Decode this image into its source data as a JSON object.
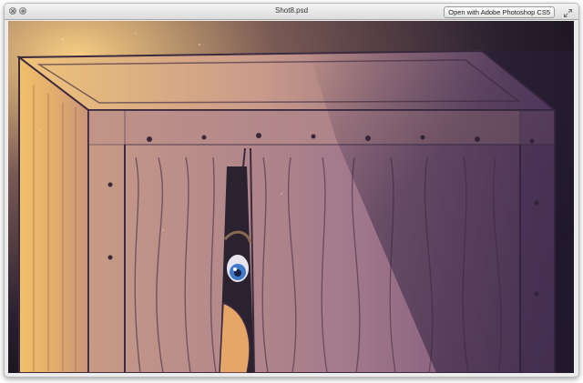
{
  "window": {
    "title": "Shot8.psd",
    "open_button_label": "Open with Adobe Photoshop CS5"
  },
  "icons": {
    "close": "close-icon",
    "zoom": "zoom-icon",
    "fullscreen": "fullscreen-arrows-icon"
  },
  "colors": {
    "wood_light": "#c79a88",
    "wood_dark": "#6e4a6a",
    "shadow": "#3b2a48",
    "glow": "#f4c36b",
    "eye": "#3f79c8"
  }
}
